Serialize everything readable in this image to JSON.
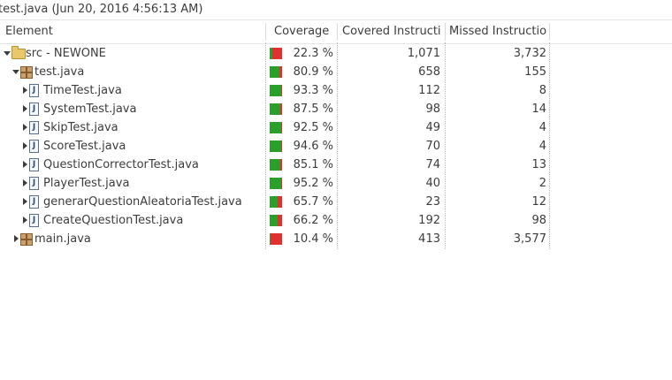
{
  "session_title": "test.java (Jun 20, 2016 4:56:13 AM)",
  "columns": {
    "element": "Element",
    "coverage": "Coverage",
    "covered": "Covered Instructi",
    "missed": "Missed Instructio"
  },
  "colors": {
    "covered_bar": "#2aa02a",
    "missed_bar": "#e03030"
  },
  "rows": [
    {
      "name": "src - NEWONE",
      "icon": "source-folder-icon",
      "expanded": true,
      "depth": 0,
      "coverage": "22.3 %",
      "covered": "1,071",
      "missed": "3,732",
      "ratio": 0.223
    },
    {
      "name": "test.java",
      "icon": "package-icon",
      "expanded": true,
      "depth": 1,
      "coverage": "80.9 %",
      "covered": "658",
      "missed": "155",
      "ratio": 0.809
    },
    {
      "name": "TimeTest.java",
      "icon": "java-file-icon",
      "expanded": false,
      "depth": 2,
      "coverage": "93.3 %",
      "covered": "112",
      "missed": "8",
      "ratio": 0.933
    },
    {
      "name": "SystemTest.java",
      "icon": "java-file-icon",
      "expanded": false,
      "depth": 2,
      "coverage": "87.5 %",
      "covered": "98",
      "missed": "14",
      "ratio": 0.875
    },
    {
      "name": "SkipTest.java",
      "icon": "java-file-icon",
      "expanded": false,
      "depth": 2,
      "coverage": "92.5 %",
      "covered": "49",
      "missed": "4",
      "ratio": 0.925
    },
    {
      "name": "ScoreTest.java",
      "icon": "java-file-icon",
      "expanded": false,
      "depth": 2,
      "coverage": "94.6 %",
      "covered": "70",
      "missed": "4",
      "ratio": 0.946
    },
    {
      "name": "QuestionCorrectorTest.java",
      "icon": "java-file-icon",
      "expanded": false,
      "depth": 2,
      "coverage": "85.1 %",
      "covered": "74",
      "missed": "13",
      "ratio": 0.851
    },
    {
      "name": "PlayerTest.java",
      "icon": "java-file-icon",
      "expanded": false,
      "depth": 2,
      "coverage": "95.2 %",
      "covered": "40",
      "missed": "2",
      "ratio": 0.952
    },
    {
      "name": "generarQuestionAleatoriaTest.java",
      "icon": "java-file-icon",
      "expanded": false,
      "depth": 2,
      "coverage": "65.7 %",
      "covered": "23",
      "missed": "12",
      "ratio": 0.657
    },
    {
      "name": "CreateQuestionTest.java",
      "icon": "java-file-icon",
      "expanded": false,
      "depth": 2,
      "coverage": "66.2 %",
      "covered": "192",
      "missed": "98",
      "ratio": 0.662
    },
    {
      "name": "main.java",
      "icon": "package-icon",
      "expanded": false,
      "depth": 1,
      "coverage": "10.4 %",
      "covered": "413",
      "missed": "3,577",
      "ratio": 0.104
    }
  ]
}
